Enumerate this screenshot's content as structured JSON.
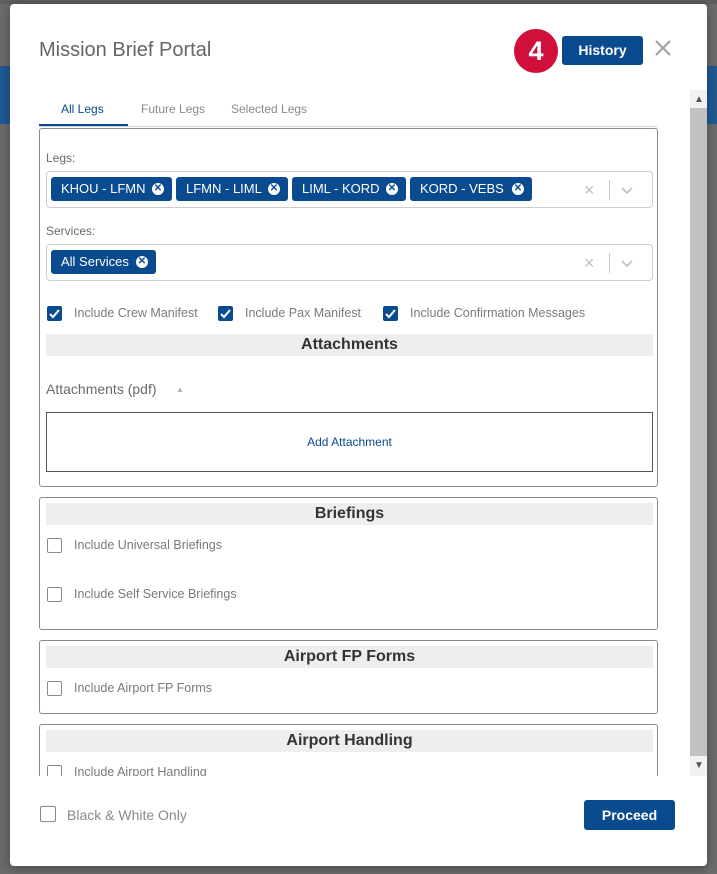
{
  "modal": {
    "title": "Mission Brief Portal",
    "badge": "4",
    "history_label": "History",
    "close_icon": "close-icon"
  },
  "tabs": [
    {
      "label": "All Legs",
      "active": true
    },
    {
      "label": "Future Legs",
      "active": false
    },
    {
      "label": "Selected Legs",
      "active": false
    }
  ],
  "legs": {
    "label": "Legs:",
    "chips": [
      "KHOU - LFMN",
      "LFMN - LIML",
      "LIML - KORD",
      "KORD - VEBS"
    ]
  },
  "services": {
    "label": "Services:",
    "chips": [
      "All Services"
    ]
  },
  "include_options": [
    {
      "label": "Include Crew Manifest",
      "checked": true
    },
    {
      "label": "Include Pax Manifest",
      "checked": true
    },
    {
      "label": "Include Confirmation Messages",
      "checked": true
    }
  ],
  "attachments": {
    "header": "Attachments",
    "list_label": "Attachments (pdf)",
    "add_label": "Add Attachment"
  },
  "briefings": {
    "header": "Briefings",
    "options": [
      {
        "label": "Include Universal Briefings",
        "checked": false
      },
      {
        "label": "Include Self Service Briefings",
        "checked": false
      }
    ]
  },
  "airport_fp_forms": {
    "header": "Airport FP Forms",
    "options": [
      {
        "label": "Include Airport FP Forms",
        "checked": false
      }
    ]
  },
  "airport_handling": {
    "header": "Airport Handling",
    "options": [
      {
        "label": "Include Airport Handling",
        "checked": false
      }
    ]
  },
  "footer": {
    "bw_label": "Black & White Only",
    "bw_checked": false,
    "proceed_label": "Proceed"
  },
  "colors": {
    "primary": "#0a4a8e",
    "badge": "#d0103a"
  }
}
